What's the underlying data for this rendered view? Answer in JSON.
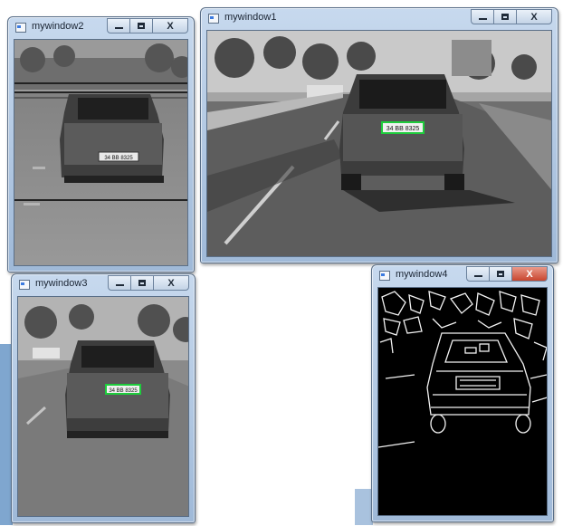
{
  "windows": {
    "w2": {
      "title": "mywindow2",
      "controls": {
        "minimize": "–",
        "maximize": "□",
        "close": "X"
      },
      "plate": "34 BB 8325"
    },
    "w1": {
      "title": "mywindow1",
      "controls": {
        "minimize": "–",
        "maximize": "□",
        "close": "X"
      },
      "plate": "34 BB 8325"
    },
    "w3": {
      "title": "mywindow3",
      "controls": {
        "minimize": "–",
        "maximize": "□",
        "close": "X"
      },
      "plate": "34 BB 8325"
    },
    "w4": {
      "title": "mywindow4",
      "controls": {
        "minimize": "–",
        "maximize": "□",
        "close": "X"
      }
    }
  },
  "colors": {
    "plate_highlight": "#1ecc3c",
    "close_active": "#c8452e",
    "titlebar": "#b6cce6"
  },
  "icons": [
    "app-icon",
    "minimize-icon",
    "maximize-icon",
    "close-icon"
  ]
}
